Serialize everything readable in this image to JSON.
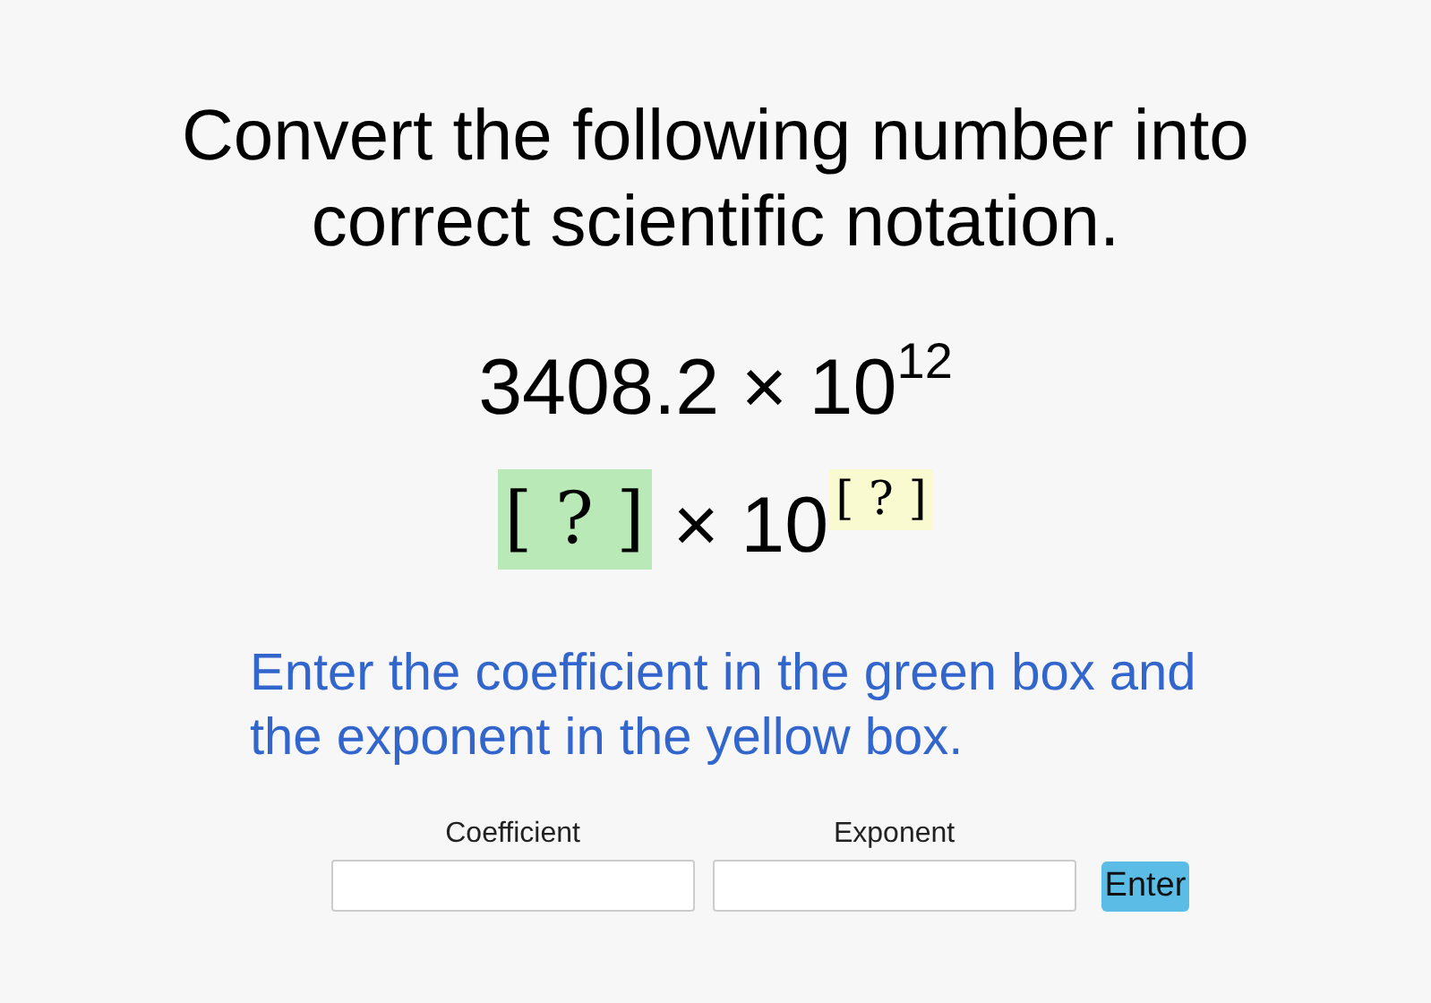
{
  "question": "Convert the following number into correct scientific notation.",
  "given": "3408.2 × 10$^{12}$",
  "answer_template": {
    "coefficient_slot": "[ ? ]",
    "times": "× 10",
    "exponent_slot": "[ ? ]"
  },
  "instruction": "Enter the coefficient in the green box and the exponent in the yellow box.",
  "fields": [
    {
      "label": "Coefficient"
    },
    {
      "label": "Exponent"
    }
  ],
  "submit_button": "Enter"
}
